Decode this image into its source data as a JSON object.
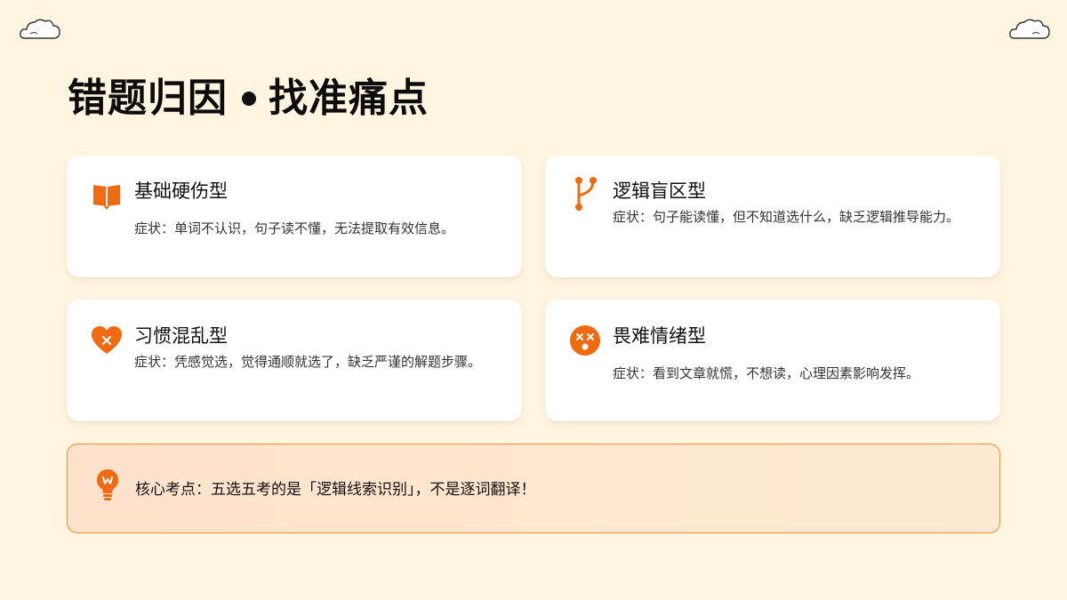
{
  "title": {
    "left": "错题归因",
    "right": "找准痛点"
  },
  "cards": [
    {
      "icon": "book-icon",
      "heading": "基础硬伤型",
      "desc": "症状：单词不认识，句子读不懂，无法提取有效信息。"
    },
    {
      "icon": "branch-icon",
      "heading": "逻辑盲区型",
      "desc": "症状：句子能读懂，但不知道选什么，缺乏逻辑推导能力。"
    },
    {
      "icon": "heart-x-icon",
      "heading": "习惯混乱型",
      "desc": "症状：凭感觉选，觉得通顺就选了，缺乏严谨的解题步骤。"
    },
    {
      "icon": "dizzy-face-icon",
      "heading": "畏难情绪型",
      "desc": "症状：看到文章就慌，不想读，心理因素影响发挥。"
    }
  ],
  "tip": {
    "icon": "lightbulb-icon",
    "text": "核心考点：五选五考的是「逻辑线索识别」，不是逐词翻译！"
  },
  "colors": {
    "background": "#FFF5E0",
    "accent": "#F26A0F",
    "tip_border": "#F28C28",
    "tip_background": "#FFE5CF"
  }
}
